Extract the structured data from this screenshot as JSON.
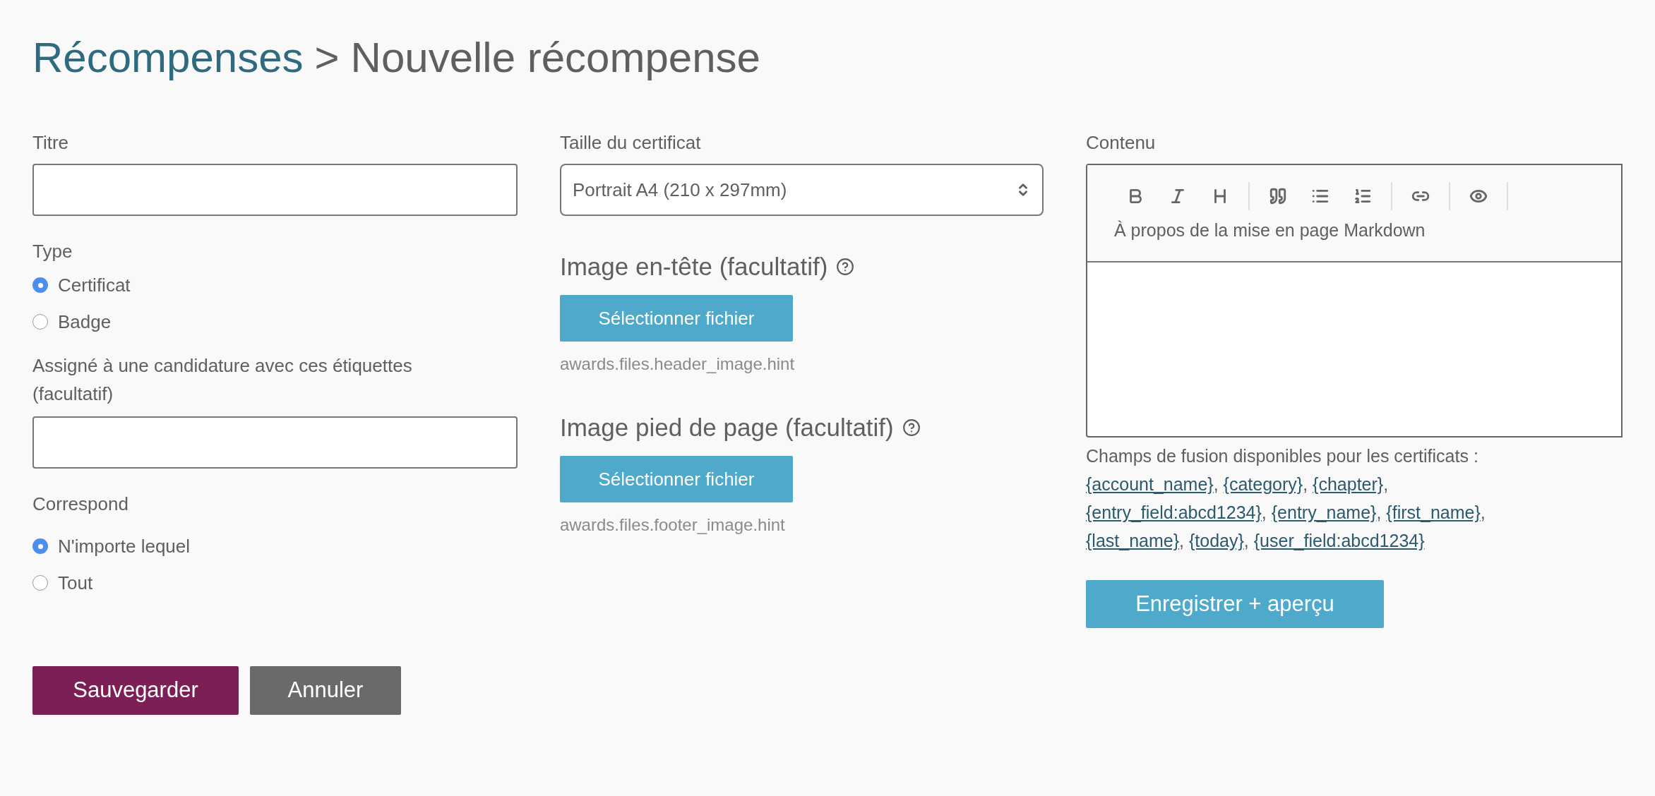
{
  "breadcrumb": {
    "parent": "Récompenses",
    "separator": ">",
    "current": "Nouvelle récompense"
  },
  "left": {
    "title_field": {
      "label": "Titre"
    },
    "type": {
      "label": "Type",
      "options": [
        {
          "label": "Certificat",
          "selected": true
        },
        {
          "label": "Badge",
          "selected": false
        }
      ]
    },
    "tags_field": {
      "label": "Assigné à une candidature avec ces étiquettes (facultatif)"
    },
    "match": {
      "label": "Correspond",
      "options": [
        {
          "label": "N'importe lequel",
          "selected": true
        },
        {
          "label": "Tout",
          "selected": false
        }
      ]
    }
  },
  "middle": {
    "size": {
      "label": "Taille du certificat",
      "value": "Portrait A4 (210 x 297mm)"
    },
    "uploads": [
      {
        "heading": "Image en-tête (facultatif)",
        "button": "Sélectionner fichier",
        "hint": "awards.files.header_image.hint"
      },
      {
        "heading": "Image pied de page (facultatif)",
        "button": "Sélectionner fichier",
        "hint": "awards.files.footer_image.hint"
      }
    ]
  },
  "right": {
    "label": "Contenu",
    "toolbar": [
      {
        "kind": "bold"
      },
      {
        "kind": "italic"
      },
      {
        "kind": "heading"
      },
      {
        "kind": "sep"
      },
      {
        "kind": "quote"
      },
      {
        "kind": "bullets"
      },
      {
        "kind": "numbers"
      },
      {
        "kind": "sep"
      },
      {
        "kind": "link"
      },
      {
        "kind": "sep"
      },
      {
        "kind": "preview"
      },
      {
        "kind": "sep"
      }
    ],
    "help_link": "À propos de la mise en page Markdown",
    "merge_label": "Champs de fusion disponibles pour les certificats :",
    "merge_fields": [
      "{account_name}",
      "{category}",
      "{chapter}",
      "{entry_field:abcd1234}",
      "{entry_name}",
      "{first_name}",
      "{last_name}",
      "{today}",
      "{user_field:abcd1234}"
    ],
    "merge_separator": ",",
    "preview_button": "Enregistrer + aperçu"
  },
  "actions": {
    "save": "Sauvegarder",
    "cancel": "Annuler"
  }
}
